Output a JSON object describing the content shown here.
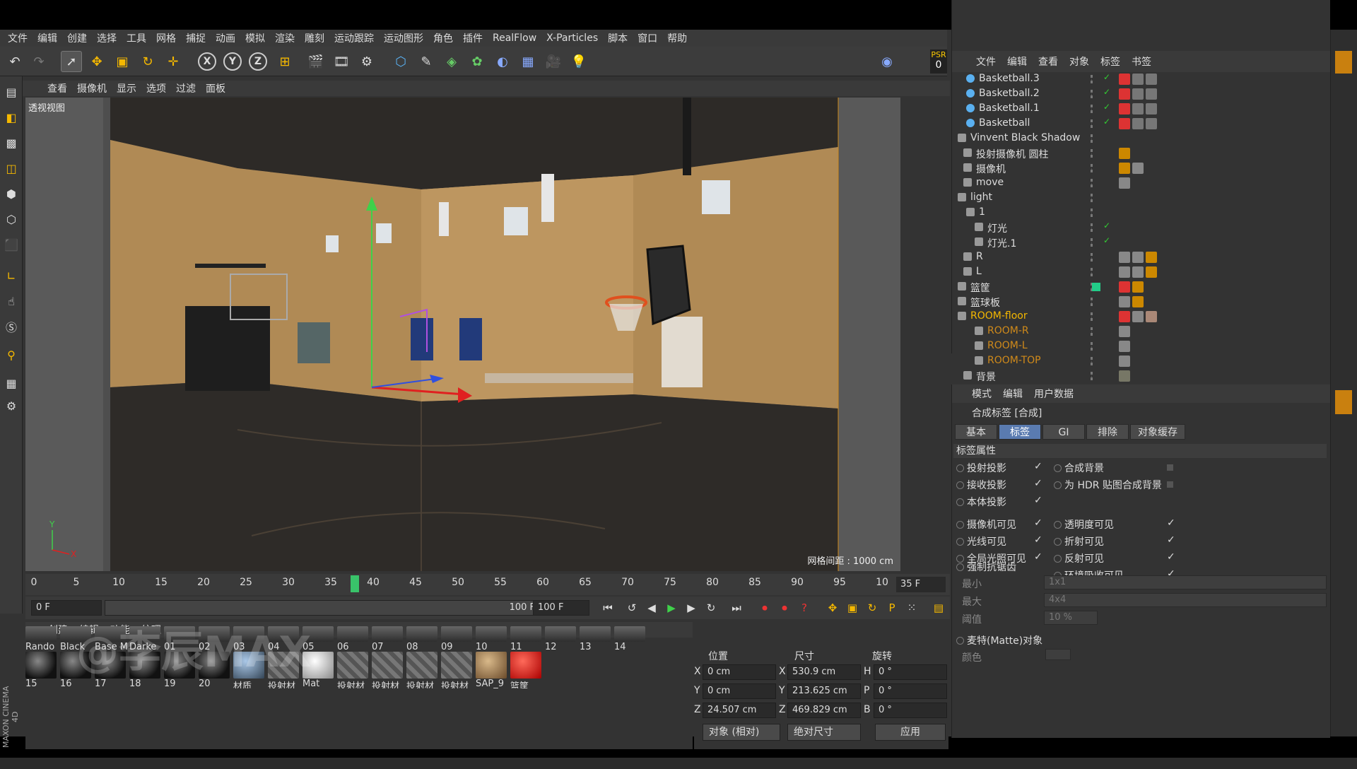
{
  "menu": [
    "文件",
    "编辑",
    "创建",
    "选择",
    "工具",
    "网格",
    "捕捉",
    "动画",
    "模拟",
    "渲染",
    "雕刻",
    "运动跟踪",
    "运动图形",
    "角色",
    "插件",
    "RealFlow",
    "X-Particles",
    "脚本",
    "窗口",
    "帮助"
  ],
  "toolbar": {
    "axis_x": "X",
    "axis_y": "Y",
    "axis_z": "Z",
    "psr_label": "PSR",
    "psr_value": "0"
  },
  "viewport": {
    "menu": [
      "查看",
      "摄像机",
      "显示",
      "选项",
      "过滤",
      "面板"
    ],
    "label": "透视视图",
    "grid_label": "网格间距 : 1000 cm",
    "axis_y": "Y",
    "axis_x": "X"
  },
  "timeline": {
    "ticks": [
      "0",
      "5",
      "10",
      "15",
      "20",
      "25",
      "30",
      "35",
      "40",
      "45",
      "50",
      "55",
      "60",
      "65",
      "70",
      "75",
      "80",
      "85",
      "90",
      "95",
      "10"
    ],
    "current_frame": "35 F"
  },
  "transport": {
    "start": "0 F",
    "end_slider": "100 F",
    "end": "100 F"
  },
  "materials": {
    "menu": [
      "创建",
      "编辑",
      "功能",
      "纹理"
    ],
    "row1": [
      "Rando",
      "Black",
      "Base M",
      "Darke",
      "01",
      "02",
      "03",
      "04",
      "05",
      "06",
      "07",
      "08",
      "09",
      "10",
      "11",
      "12",
      "13",
      "14"
    ],
    "row2": [
      "15",
      "16",
      "17",
      "18",
      "19",
      "20",
      "材质",
      "投射材",
      "Mat",
      "投射材",
      "投射材",
      "投射材",
      "投射材",
      "SAP_9",
      "篮筐"
    ]
  },
  "coords": {
    "headers": {
      "position": "位置",
      "size": "尺寸",
      "rotation": "旋转"
    },
    "labels": {
      "x": "X",
      "y": "Y",
      "z": "Z",
      "sx": "X",
      "sy": "Y",
      "sz": "Z",
      "h": "H",
      "p": "P",
      "b": "B"
    },
    "position": {
      "x": "0 cm",
      "y": "0 cm",
      "z": "24.507 cm"
    },
    "size": {
      "x": "530.9 cm",
      "y": "213.625 cm",
      "z": "469.829 cm"
    },
    "rotation": {
      "h": "0 °",
      "p": "0 °",
      "b": "0 °"
    },
    "mode": "对象 (相对)",
    "size_mode": "绝对尺寸",
    "apply": "应用"
  },
  "watermark": "@李辰MAX",
  "brand": "MAXON CINEMA 4D",
  "object_manager": {
    "menu": [
      "文件",
      "编辑",
      "查看",
      "对象",
      "标签",
      "书签"
    ],
    "objects": [
      {
        "name": "Basketball.3",
        "color": "#ddd"
      },
      {
        "name": "Basketball.2",
        "color": "#ddd"
      },
      {
        "name": "Basketball.1",
        "color": "#ddd"
      },
      {
        "name": "Basketball",
        "color": "#ddd"
      },
      {
        "name": "Vinvent Black Shadow",
        "color": "#ddd"
      },
      {
        "name": "投射摄像机 圆柱",
        "color": "#ddd"
      },
      {
        "name": "摄像机",
        "color": "#ddd"
      },
      {
        "name": "move",
        "color": "#ddd"
      },
      {
        "name": "light",
        "color": "#ddd"
      },
      {
        "name": "1",
        "color": "#ddd"
      },
      {
        "name": "灯光",
        "color": "#ddd"
      },
      {
        "name": "灯光.1",
        "color": "#ddd"
      },
      {
        "name": "R",
        "color": "#ddd"
      },
      {
        "name": "L",
        "color": "#ddd"
      },
      {
        "name": "篮筐",
        "color": "#ddd"
      },
      {
        "name": "篮球板",
        "color": "#ddd"
      },
      {
        "name": "ROOM-floor",
        "color": "#f5b800"
      },
      {
        "name": "ROOM-R",
        "color": "#d08a1a"
      },
      {
        "name": "ROOM-L",
        "color": "#d08a1a"
      },
      {
        "name": "ROOM-TOP",
        "color": "#d08a1a"
      },
      {
        "name": "背景",
        "color": "#ddd"
      }
    ]
  },
  "attributes": {
    "menu": [
      "模式",
      "编辑",
      "用户数据"
    ],
    "title": "合成标签 [合成]",
    "tabs": [
      "基本",
      "标签",
      "GI",
      "排除",
      "对象缓存"
    ],
    "section": "标签属性",
    "props_left": [
      {
        "label": "投射投影",
        "check": "✓"
      },
      {
        "label": "接收投影",
        "check": "✓"
      },
      {
        "label": "本体投影",
        "check": "✓"
      },
      {
        "label": "摄像机可见",
        "check": "✓"
      },
      {
        "label": "光线可见",
        "check": "✓"
      },
      {
        "label": "全局光照可见",
        "check": "✓"
      }
    ],
    "props_right": [
      {
        "label": "合成背景",
        "check": ""
      },
      {
        "label": "为 HDR 贴图合成背景",
        "check": ""
      },
      {
        "label": "透明度可见",
        "check": "✓"
      },
      {
        "label": "折射可见",
        "check": "✓"
      },
      {
        "label": "反射可见",
        "check": "✓"
      },
      {
        "label": "环境吸收可见",
        "check": "✓"
      }
    ],
    "aa_label": "强制抗锯齿",
    "min_label": "最小",
    "min_value": "1x1",
    "max_label": "最大",
    "max_value": "4x4",
    "threshold_label": "阈值",
    "threshold_value": "10 %",
    "matte_label": "麦特(Matte)对象",
    "color_label": "颜色"
  }
}
